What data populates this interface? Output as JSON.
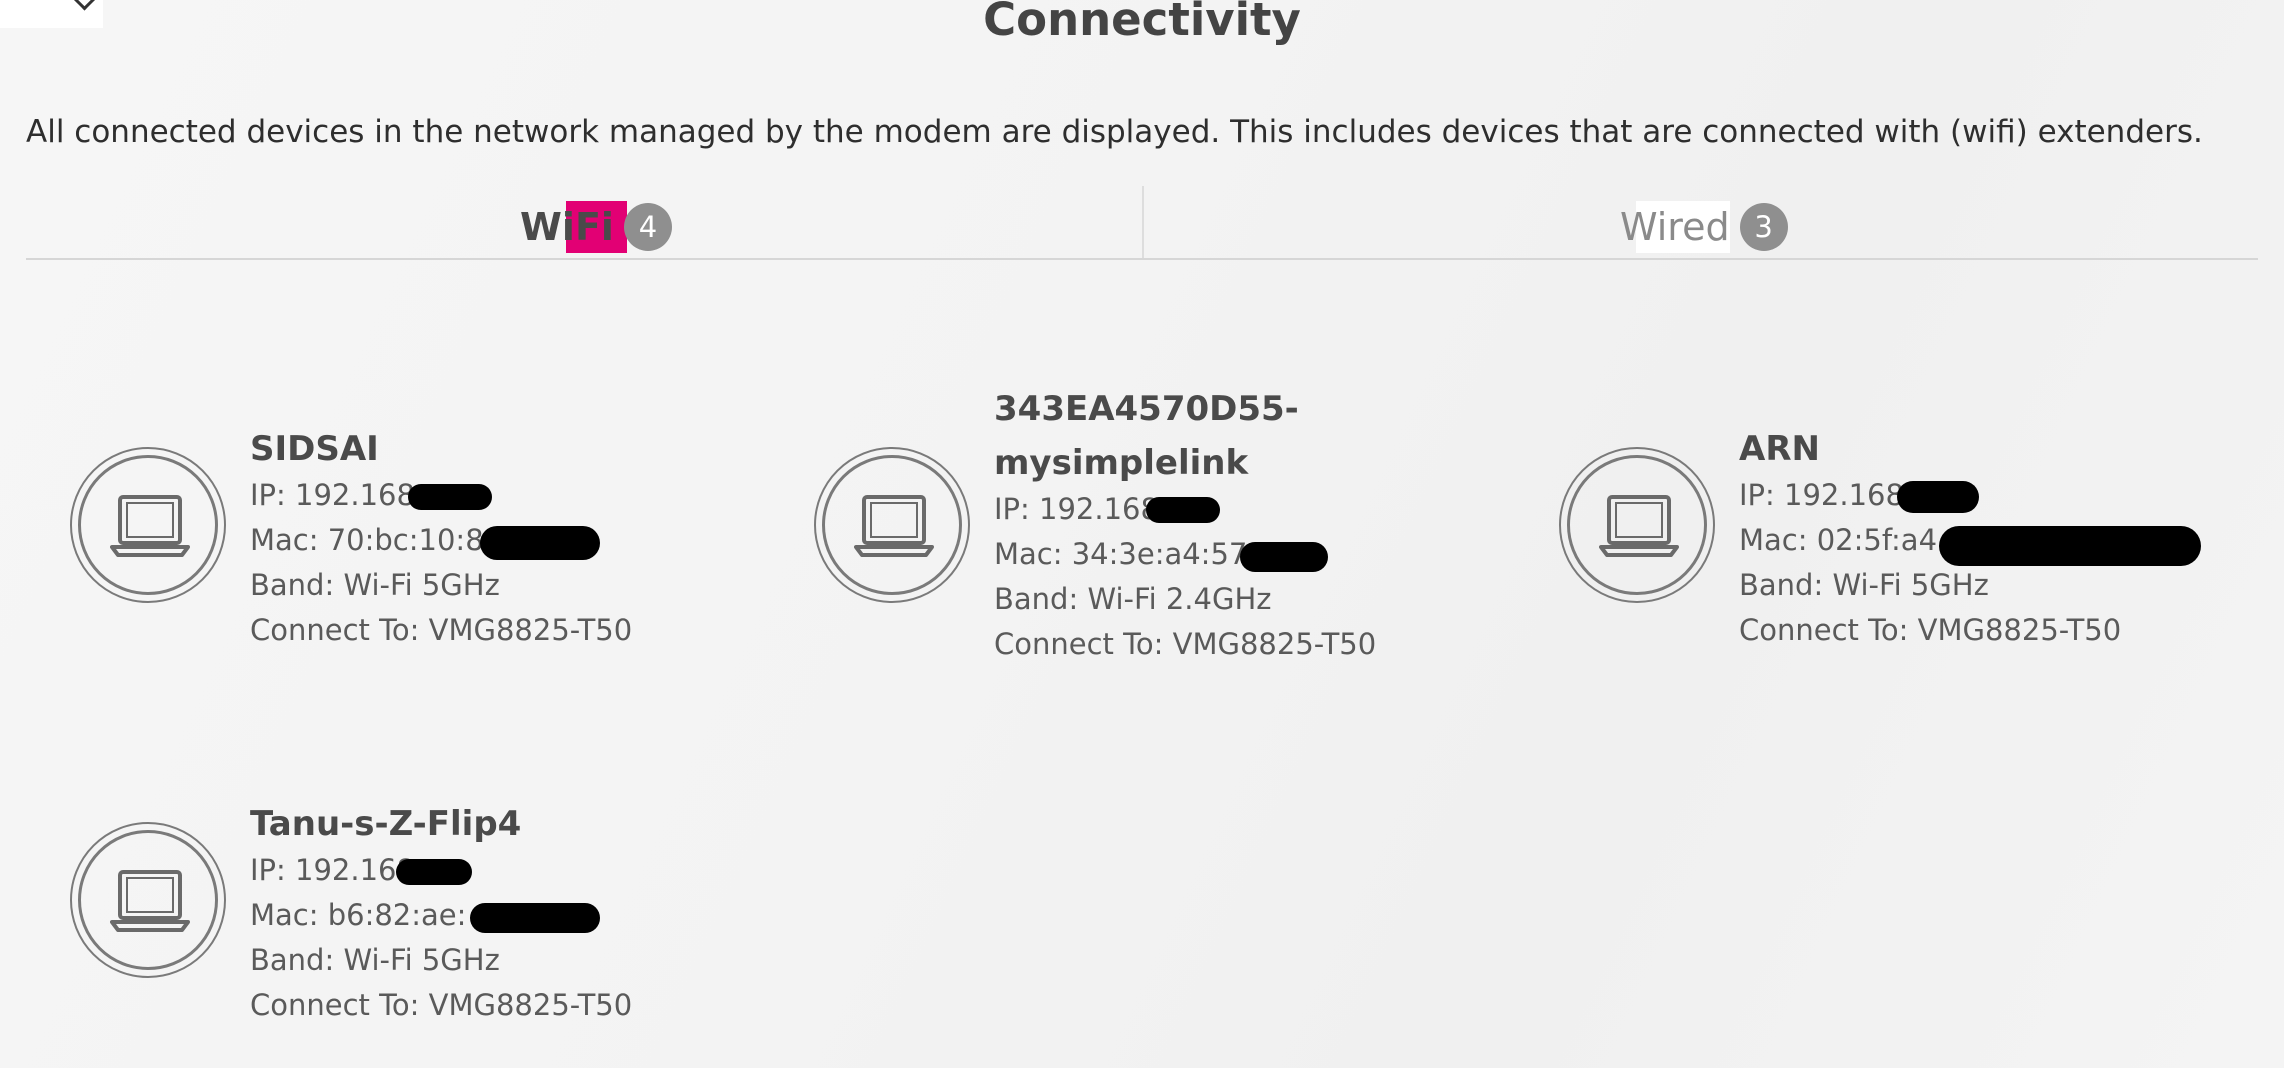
{
  "header": {
    "title": "Connectivity",
    "back_icon": "chevron-left-icon"
  },
  "description": "All connected devices in the network managed by the modem are displayed. This includes devices that are connected with (wifi) extenders.",
  "tabs": [
    {
      "label": "WiFi",
      "count": "4",
      "active": true
    },
    {
      "label": "Wired",
      "count": "3",
      "active": false
    }
  ],
  "colors": {
    "accent": "#e20074",
    "badge": "#8f8f8f"
  },
  "devices": [
    {
      "name": "SIDSAI",
      "ip": "IP: 192.168.",
      "mac": "Mac: 70:bc:10:8",
      "band": "Band: Wi-Fi 5GHz",
      "connect_to": "Connect To: VMG8825-T50",
      "icon": "laptop-icon"
    },
    {
      "name": "343EA4570D55-",
      "name_line2": "mysimplelink",
      "ip": "IP: 192.168.",
      "mac": "Mac: 34:3e:a4:57",
      "band": "Band: Wi-Fi 2.4GHz",
      "connect_to": "Connect To: VMG8825-T50",
      "icon": "laptop-icon"
    },
    {
      "name": "ARN",
      "ip": "IP: 192.168.",
      "mac": "Mac: 02:5f:a4",
      "band": "Band: Wi-Fi 5GHz",
      "connect_to": "Connect To: VMG8825-T50",
      "icon": "laptop-icon"
    },
    {
      "name": "Tanu-s-Z-Flip4",
      "ip": "IP: 192.168",
      "mac": "Mac: b6:82:ae:",
      "band": "Band: Wi-Fi 5GHz",
      "connect_to": "Connect To: VMG8825-T50",
      "icon": "laptop-icon"
    }
  ]
}
